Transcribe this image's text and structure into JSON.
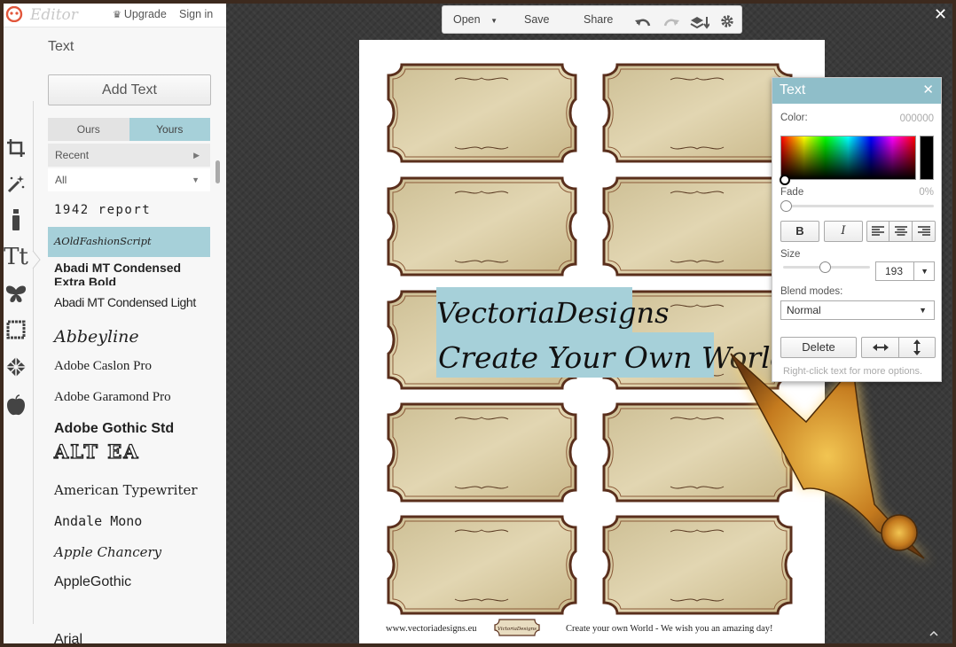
{
  "app": {
    "logo_text": "Editor",
    "upgrade_label": "Upgrade",
    "signin_label": "Sign in"
  },
  "sidebar": {
    "tools": [
      "crop-icon",
      "magic-wand-icon",
      "brush-icon",
      "text-icon",
      "butterfly-icon",
      "frame-icon",
      "texture-icon",
      "apple-icon"
    ],
    "section_title": "Text",
    "add_text_label": "Add Text",
    "tabs": [
      {
        "label": "Ours"
      },
      {
        "label": "Yours"
      }
    ],
    "active_tab": "Yours",
    "recent_label": "Recent",
    "all_label": "All",
    "fonts": [
      {
        "label": "1942 report"
      },
      {
        "label": "AOldFashionScript"
      },
      {
        "label": "Abadi MT Condensed Extra Bold"
      },
      {
        "label": "Abadi MT Condensed Light"
      },
      {
        "label": "Abbeyline"
      },
      {
        "label": "Adobe Caslon Pro"
      },
      {
        "label": "Adobe Garamond Pro"
      },
      {
        "label": "Adobe Gothic Std"
      },
      {
        "label": "ALT EA"
      },
      {
        "label": "American Typewriter"
      },
      {
        "label": "Andale Mono"
      },
      {
        "label": "Apple Chancery"
      },
      {
        "label": "AppleGothic"
      },
      {
        "label": "Arial"
      }
    ],
    "selected_font": "AOldFashionScript"
  },
  "toolbar": {
    "open_label": "Open",
    "save_label": "Save",
    "share_label": "Share"
  },
  "canvas": {
    "text_line1": "VectoriaDesigns",
    "text_line2": "Create Your Own World",
    "footer_left": "www.vectoriadesigns.eu",
    "footer_right": "Create your own World - We wish you an amazing day!",
    "logo_text": "VictoriaDesigns",
    "label_count": 10
  },
  "text_panel": {
    "title": "Text",
    "color_label": "Color:",
    "color_value": "000000",
    "fade_label": "Fade",
    "fade_value": "0%",
    "bold_label": "B",
    "italic_label": "I",
    "size_label": "Size",
    "size_value": "193",
    "blend_label": "Blend modes:",
    "blend_value": "Normal",
    "delete_label": "Delete",
    "hint": "Right-click text for more options."
  },
  "colors": {
    "accent": "#a6d0d9",
    "panel_header": "#8fbec9",
    "frame": "#3d2a1e"
  }
}
